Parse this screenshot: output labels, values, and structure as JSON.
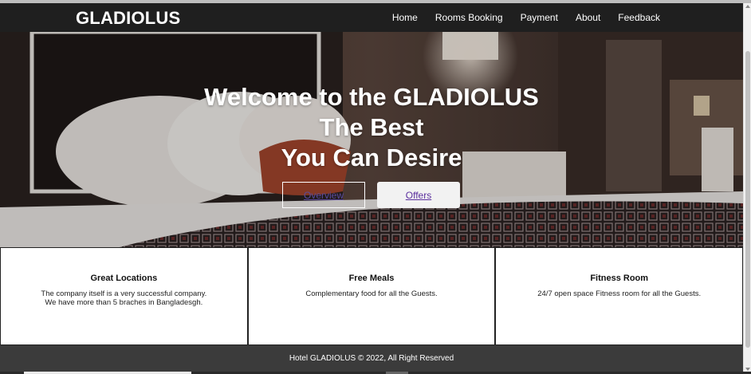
{
  "header": {
    "brand": "GLADIOLUS",
    "nav": [
      {
        "label": "Home"
      },
      {
        "label": "Rooms Booking"
      },
      {
        "label": "Payment"
      },
      {
        "label": "About"
      },
      {
        "label": "Feedback"
      }
    ]
  },
  "hero": {
    "title_line1": "Welcome to the GLADIOLUS",
    "title_line2": "The Best",
    "title_line3": "You Can Desire",
    "overview_label": "Overview",
    "offers_label": "Offers"
  },
  "features": [
    {
      "title": "Great Locations",
      "line1": "The company itself is a very successful company.",
      "line2": "We have more than 5 braches in Bangladesgh."
    },
    {
      "title": "Free Meals",
      "line1": "Complementary food for all the Guests.",
      "line2": ""
    },
    {
      "title": "Fitness Room",
      "line1": "24/7 open space Fitness room for all the Guests.",
      "line2": ""
    }
  ],
  "footer": {
    "text": "Hotel GLADIOLUS © 2022, All Right Reserved"
  },
  "colors": {
    "navbar": "#1f1f1f",
    "footer": "#3b3b3b",
    "link_visited": "#5b2f9e"
  }
}
